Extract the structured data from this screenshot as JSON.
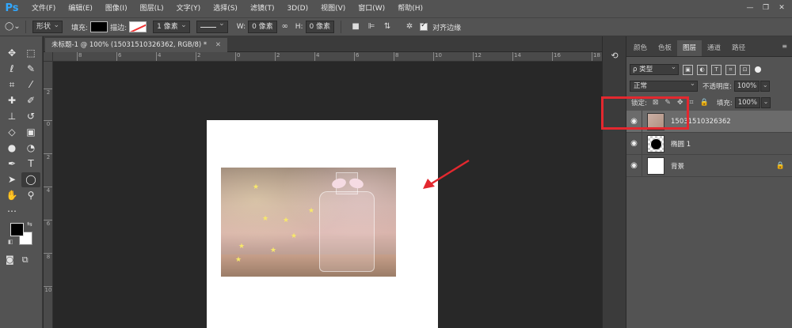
{
  "app": {
    "logo": "Ps"
  },
  "menu": [
    "文件(F)",
    "编辑(E)",
    "图像(I)",
    "图层(L)",
    "文字(Y)",
    "选择(S)",
    "滤镜(T)",
    "3D(D)",
    "视图(V)",
    "窗口(W)",
    "帮助(H)"
  ],
  "window_controls": [
    "—",
    "❐",
    "✕"
  ],
  "options": {
    "shape_mode": "形状",
    "fill_label": "填充:",
    "stroke_label": "描边:",
    "stroke_width": "1 像素",
    "width_label": "W:",
    "width_value": "0 像素",
    "height_label": "H:",
    "height_value": "0 像素",
    "align_edges_label": "对齐边缘"
  },
  "document": {
    "tab_title": "未标题-1 @ 100% (15031510326362, RGB/8) *",
    "ruler_h": [
      "8",
      "6",
      "4",
      "2",
      "0",
      "2",
      "4",
      "6",
      "8",
      "10",
      "12",
      "14",
      "16",
      "18"
    ],
    "ruler_v": [
      "2",
      "0",
      "2",
      "4",
      "6",
      "8",
      "10"
    ]
  },
  "layers_panel": {
    "tabs": [
      "颜色",
      "色板",
      "图层",
      "通道",
      "路径"
    ],
    "active_tab": "图层",
    "kind_filter": "ρ 类型",
    "blend_mode": "正常",
    "opacity_label": "不透明度:",
    "opacity_value": "100%",
    "lock_label": "锁定:",
    "fill_label": "填充:",
    "fill_value": "100%",
    "layers": [
      {
        "name": "15031510326362",
        "selected": true,
        "thumb": "photo"
      },
      {
        "name": "椭圆 1",
        "selected": false,
        "thumb": "shape"
      },
      {
        "name": "背景",
        "selected": false,
        "thumb": "white",
        "locked": true
      }
    ]
  },
  "colors": {
    "menubar": "#535353",
    "canvas_bg": "#282828",
    "highlight_red": "#e3282f",
    "ps_blue": "#31a8ff"
  },
  "icons": [
    "move-icon",
    "marquee-icon",
    "lasso-icon",
    "quick-select-icon",
    "crop-icon",
    "eyedropper-icon",
    "heal-icon",
    "brush-icon",
    "stamp-icon",
    "history-brush-icon",
    "eraser-icon",
    "gradient-icon",
    "blur-icon",
    "dodge-icon",
    "pen-icon",
    "type-icon",
    "path-select-icon",
    "ellipse-icon",
    "hand-icon",
    "zoom-icon",
    "more-icon",
    "eye-icon",
    "lock-icon"
  ]
}
